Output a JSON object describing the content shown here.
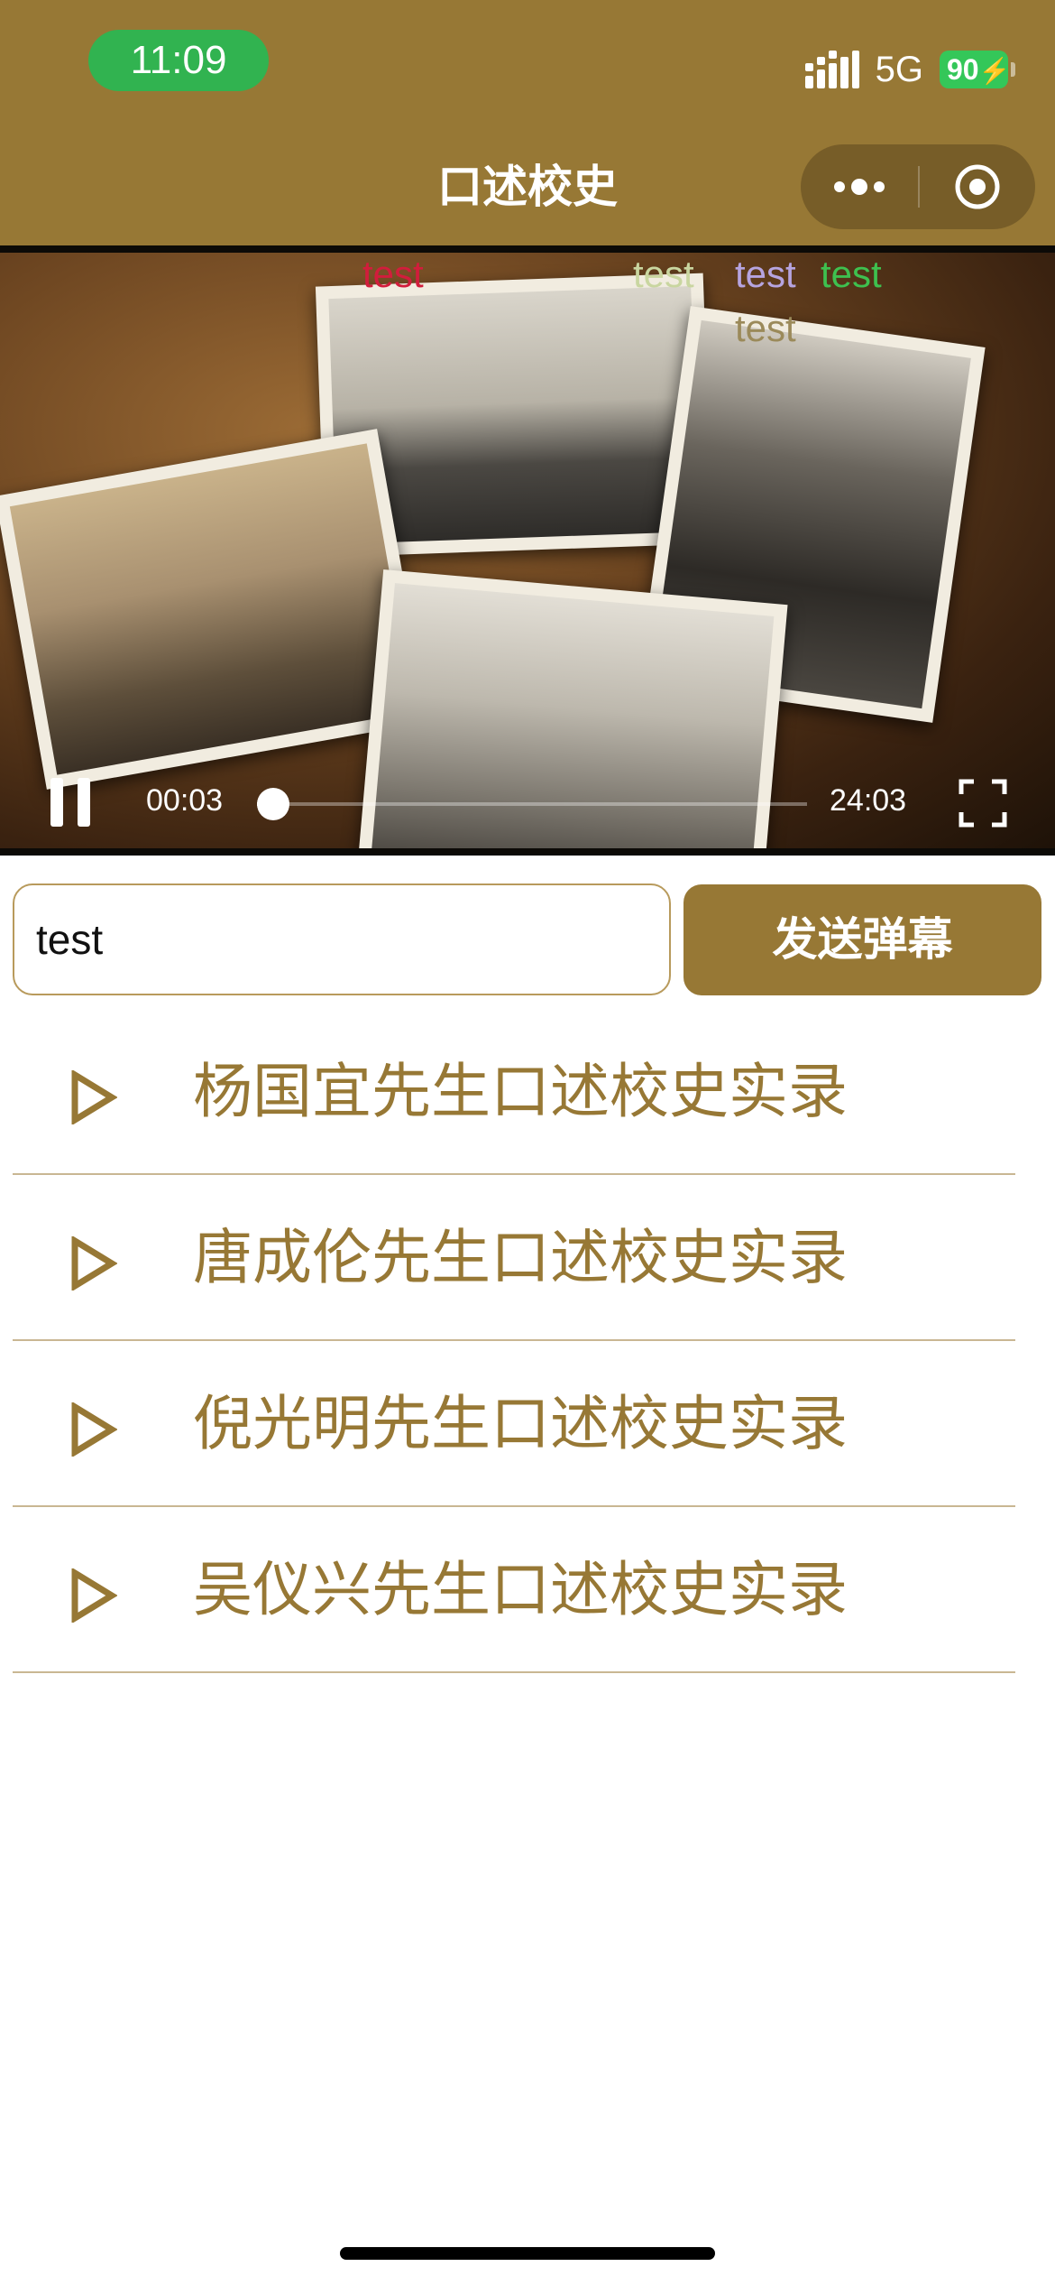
{
  "status_bar": {
    "time": "11:09",
    "network": "5G",
    "battery": "90"
  },
  "nav": {
    "title": "口述校史"
  },
  "video": {
    "danmaku": [
      "test",
      "test",
      "test",
      "test",
      "test"
    ],
    "current_time": "00:03",
    "duration": "24:03",
    "progress": 0.002,
    "state": "playing"
  },
  "danmaku_form": {
    "input_value": "test",
    "send_label": "发送弹幕"
  },
  "list": {
    "items": [
      {
        "label": "杨国宜先生口述校史实录"
      },
      {
        "label": "唐成伦先生口述校史实录"
      },
      {
        "label": "倪光明先生口述校史实录"
      },
      {
        "label": "吴仪兴先生口述校史实录"
      }
    ]
  },
  "colors": {
    "brand": "#977835",
    "time_pill": "#31b350",
    "battery": "#34c759"
  }
}
